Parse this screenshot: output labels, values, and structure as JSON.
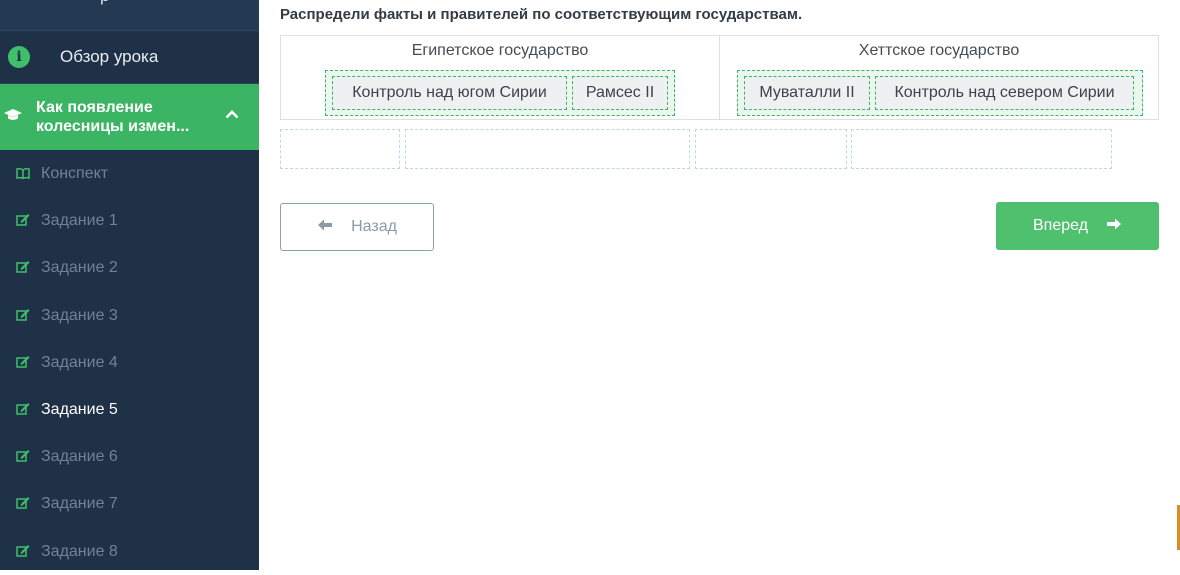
{
  "sidebar": {
    "top_partial_label": "р",
    "overview": {
      "label": "Обзор урока",
      "icon": "info-icon"
    },
    "lesson": {
      "label": "Как появление колесницы измен...",
      "icon": "graduation-cap-icon",
      "toggle_icon": "chevron-up-icon"
    },
    "items": [
      {
        "label": "Конспект",
        "icon": "book-icon"
      },
      {
        "label": "Задание 1",
        "icon": "edit-icon"
      },
      {
        "label": "Задание 2",
        "icon": "edit-icon"
      },
      {
        "label": "Задание 3",
        "icon": "edit-icon"
      },
      {
        "label": "Задание 4",
        "icon": "edit-icon"
      },
      {
        "label": "Задание 5",
        "icon": "edit-icon",
        "current": true
      },
      {
        "label": "Задание 6",
        "icon": "edit-icon"
      },
      {
        "label": "Задание 7",
        "icon": "edit-icon"
      },
      {
        "label": "Задание 8",
        "icon": "edit-icon"
      }
    ]
  },
  "task": {
    "instruction": "Распредели факты и правителей по соответствующим государствам.",
    "columns": [
      {
        "title": "Египетское государство",
        "chips": [
          "Контроль над югом Сирии",
          "Рамсес II"
        ]
      },
      {
        "title": "Хеттское государство",
        "chips": [
          "Муваталли II",
          "Контроль над севером Сирии"
        ]
      }
    ]
  },
  "nav": {
    "back_label": "Назад",
    "next_label": "Вперед"
  },
  "colors": {
    "sidebar_bg": "#1e3146",
    "accent_green": "#3bb463",
    "button_green": "#4ec06e"
  }
}
